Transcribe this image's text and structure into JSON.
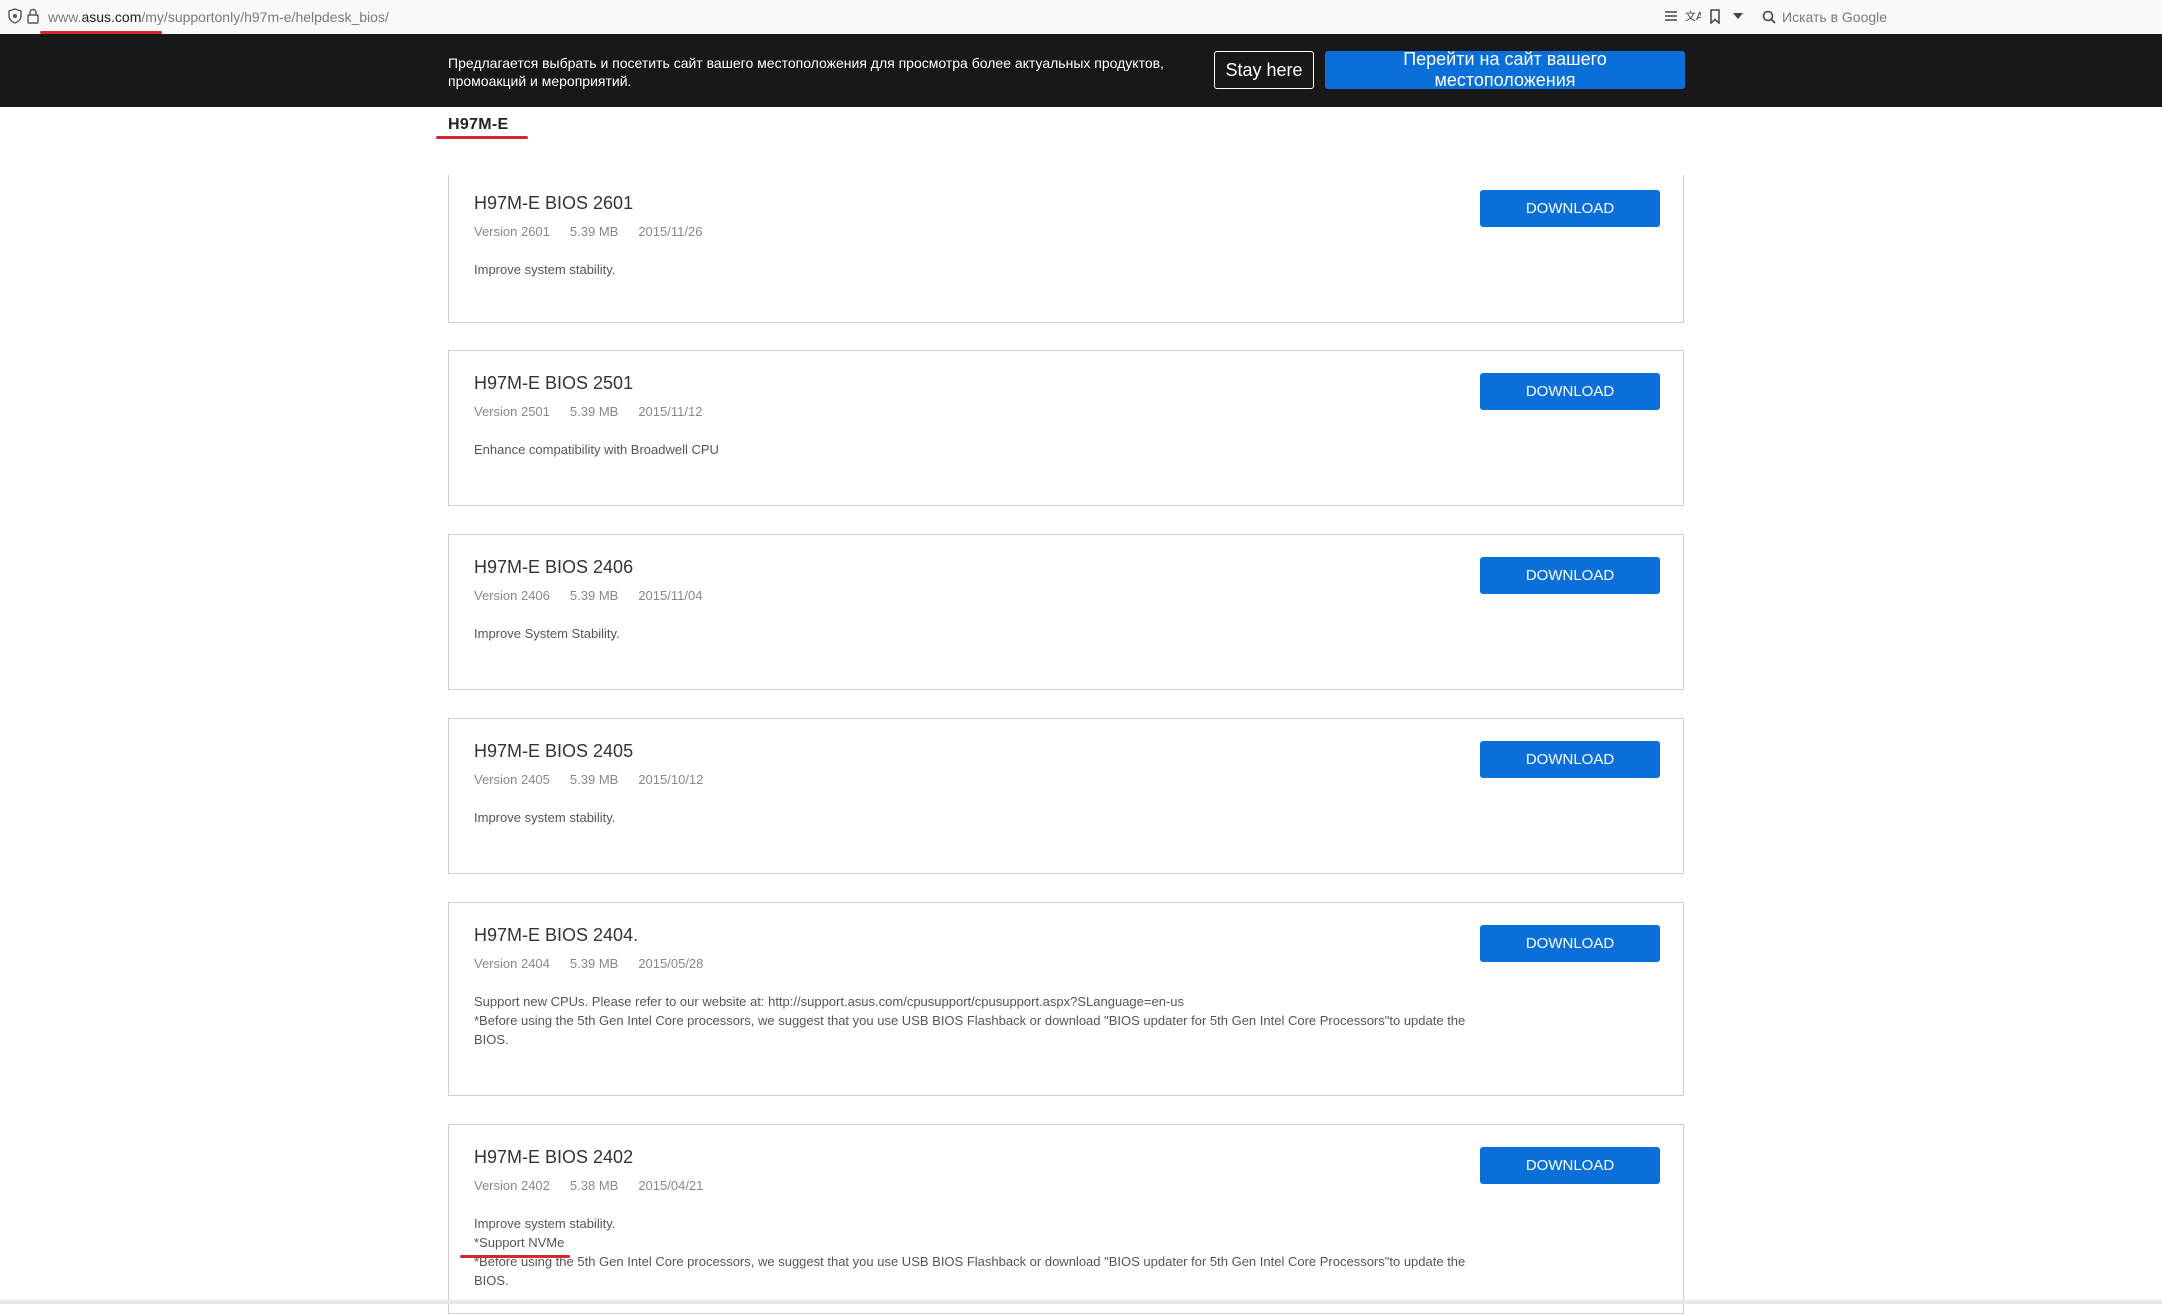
{
  "browser": {
    "url_prefix": "www.",
    "url_domain": "asus.com",
    "url_path": "/my/supportonly/h97m-e/helpdesk_bios/",
    "search_placeholder": "Искать в Google"
  },
  "banner": {
    "text": "Предлагается выбрать и посетить сайт вашего местоположения для просмотра более актуальных продуктов, промоакций и мероприятий.",
    "stay_label": "Stay here",
    "go_label": "Перейти на сайт вашего местоположения"
  },
  "model": "H97M-E",
  "items": [
    {
      "title": "H97M-E BIOS 2601",
      "version": "Version 2601",
      "size": "5.39 MB",
      "date": "2015/11/26",
      "desc": [
        "Improve system stability."
      ],
      "button": "DOWNLOAD"
    },
    {
      "title": "H97M-E BIOS 2501",
      "version": "Version 2501",
      "size": "5.39 MB",
      "date": "2015/11/12",
      "desc": [
        "Enhance compatibility with Broadwell CPU"
      ],
      "button": "DOWNLOAD"
    },
    {
      "title": "H97M-E BIOS 2406",
      "version": "Version 2406",
      "size": "5.39 MB",
      "date": "2015/11/04",
      "desc": [
        "Improve System Stability."
      ],
      "button": "DOWNLOAD"
    },
    {
      "title": "H97M-E BIOS 2405",
      "version": "Version 2405",
      "size": "5.39 MB",
      "date": "2015/10/12",
      "desc": [
        "Improve system stability."
      ],
      "button": "DOWNLOAD"
    },
    {
      "title": "H97M-E BIOS 2404.",
      "version": "Version 2404",
      "size": "5.39 MB",
      "date": "2015/05/28",
      "desc": [
        "Support new CPUs. Please refer to our website at: http://support.asus.com/cpusupport/cpusupport.aspx?SLanguage=en-us",
        "*Before using the 5th Gen Intel Core processors, we suggest that you use USB BIOS Flashback or download \"BIOS updater for 5th Gen Intel Core Processors\"to update the BIOS."
      ],
      "button": "DOWNLOAD"
    },
    {
      "title": "H97M-E BIOS 2402",
      "version": "Version 2402",
      "size": "5.38 MB",
      "date": "2015/04/21",
      "desc": [
        "Improve system stability.",
        "*Support NVMe",
        "*Before using the 5th Gen Intel Core processors, we suggest that you use USB BIOS Flashback or download \"BIOS updater for 5th Gen Intel Core Processors\"to update the BIOS."
      ],
      "button": "DOWNLOAD"
    }
  ]
}
